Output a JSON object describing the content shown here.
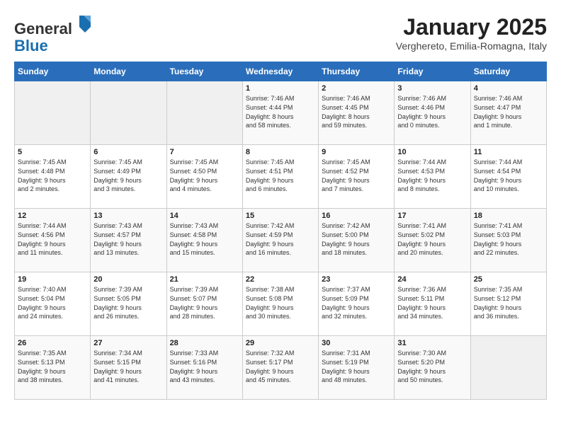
{
  "header": {
    "logo_line1": "General",
    "logo_line2": "Blue",
    "month": "January 2025",
    "location": "Verghereto, Emilia-Romagna, Italy"
  },
  "weekdays": [
    "Sunday",
    "Monday",
    "Tuesday",
    "Wednesday",
    "Thursday",
    "Friday",
    "Saturday"
  ],
  "weeks": [
    [
      {
        "day": "",
        "info": ""
      },
      {
        "day": "",
        "info": ""
      },
      {
        "day": "",
        "info": ""
      },
      {
        "day": "1",
        "info": "Sunrise: 7:46 AM\nSunset: 4:44 PM\nDaylight: 8 hours\nand 58 minutes."
      },
      {
        "day": "2",
        "info": "Sunrise: 7:46 AM\nSunset: 4:45 PM\nDaylight: 8 hours\nand 59 minutes."
      },
      {
        "day": "3",
        "info": "Sunrise: 7:46 AM\nSunset: 4:46 PM\nDaylight: 9 hours\nand 0 minutes."
      },
      {
        "day": "4",
        "info": "Sunrise: 7:46 AM\nSunset: 4:47 PM\nDaylight: 9 hours\nand 1 minute."
      }
    ],
    [
      {
        "day": "5",
        "info": "Sunrise: 7:45 AM\nSunset: 4:48 PM\nDaylight: 9 hours\nand 2 minutes."
      },
      {
        "day": "6",
        "info": "Sunrise: 7:45 AM\nSunset: 4:49 PM\nDaylight: 9 hours\nand 3 minutes."
      },
      {
        "day": "7",
        "info": "Sunrise: 7:45 AM\nSunset: 4:50 PM\nDaylight: 9 hours\nand 4 minutes."
      },
      {
        "day": "8",
        "info": "Sunrise: 7:45 AM\nSunset: 4:51 PM\nDaylight: 9 hours\nand 6 minutes."
      },
      {
        "day": "9",
        "info": "Sunrise: 7:45 AM\nSunset: 4:52 PM\nDaylight: 9 hours\nand 7 minutes."
      },
      {
        "day": "10",
        "info": "Sunrise: 7:44 AM\nSunset: 4:53 PM\nDaylight: 9 hours\nand 8 minutes."
      },
      {
        "day": "11",
        "info": "Sunrise: 7:44 AM\nSunset: 4:54 PM\nDaylight: 9 hours\nand 10 minutes."
      }
    ],
    [
      {
        "day": "12",
        "info": "Sunrise: 7:44 AM\nSunset: 4:56 PM\nDaylight: 9 hours\nand 11 minutes."
      },
      {
        "day": "13",
        "info": "Sunrise: 7:43 AM\nSunset: 4:57 PM\nDaylight: 9 hours\nand 13 minutes."
      },
      {
        "day": "14",
        "info": "Sunrise: 7:43 AM\nSunset: 4:58 PM\nDaylight: 9 hours\nand 15 minutes."
      },
      {
        "day": "15",
        "info": "Sunrise: 7:42 AM\nSunset: 4:59 PM\nDaylight: 9 hours\nand 16 minutes."
      },
      {
        "day": "16",
        "info": "Sunrise: 7:42 AM\nSunset: 5:00 PM\nDaylight: 9 hours\nand 18 minutes."
      },
      {
        "day": "17",
        "info": "Sunrise: 7:41 AM\nSunset: 5:02 PM\nDaylight: 9 hours\nand 20 minutes."
      },
      {
        "day": "18",
        "info": "Sunrise: 7:41 AM\nSunset: 5:03 PM\nDaylight: 9 hours\nand 22 minutes."
      }
    ],
    [
      {
        "day": "19",
        "info": "Sunrise: 7:40 AM\nSunset: 5:04 PM\nDaylight: 9 hours\nand 24 minutes."
      },
      {
        "day": "20",
        "info": "Sunrise: 7:39 AM\nSunset: 5:05 PM\nDaylight: 9 hours\nand 26 minutes."
      },
      {
        "day": "21",
        "info": "Sunrise: 7:39 AM\nSunset: 5:07 PM\nDaylight: 9 hours\nand 28 minutes."
      },
      {
        "day": "22",
        "info": "Sunrise: 7:38 AM\nSunset: 5:08 PM\nDaylight: 9 hours\nand 30 minutes."
      },
      {
        "day": "23",
        "info": "Sunrise: 7:37 AM\nSunset: 5:09 PM\nDaylight: 9 hours\nand 32 minutes."
      },
      {
        "day": "24",
        "info": "Sunrise: 7:36 AM\nSunset: 5:11 PM\nDaylight: 9 hours\nand 34 minutes."
      },
      {
        "day": "25",
        "info": "Sunrise: 7:35 AM\nSunset: 5:12 PM\nDaylight: 9 hours\nand 36 minutes."
      }
    ],
    [
      {
        "day": "26",
        "info": "Sunrise: 7:35 AM\nSunset: 5:13 PM\nDaylight: 9 hours\nand 38 minutes."
      },
      {
        "day": "27",
        "info": "Sunrise: 7:34 AM\nSunset: 5:15 PM\nDaylight: 9 hours\nand 41 minutes."
      },
      {
        "day": "28",
        "info": "Sunrise: 7:33 AM\nSunset: 5:16 PM\nDaylight: 9 hours\nand 43 minutes."
      },
      {
        "day": "29",
        "info": "Sunrise: 7:32 AM\nSunset: 5:17 PM\nDaylight: 9 hours\nand 45 minutes."
      },
      {
        "day": "30",
        "info": "Sunrise: 7:31 AM\nSunset: 5:19 PM\nDaylight: 9 hours\nand 48 minutes."
      },
      {
        "day": "31",
        "info": "Sunrise: 7:30 AM\nSunset: 5:20 PM\nDaylight: 9 hours\nand 50 minutes."
      },
      {
        "day": "",
        "info": ""
      }
    ]
  ]
}
